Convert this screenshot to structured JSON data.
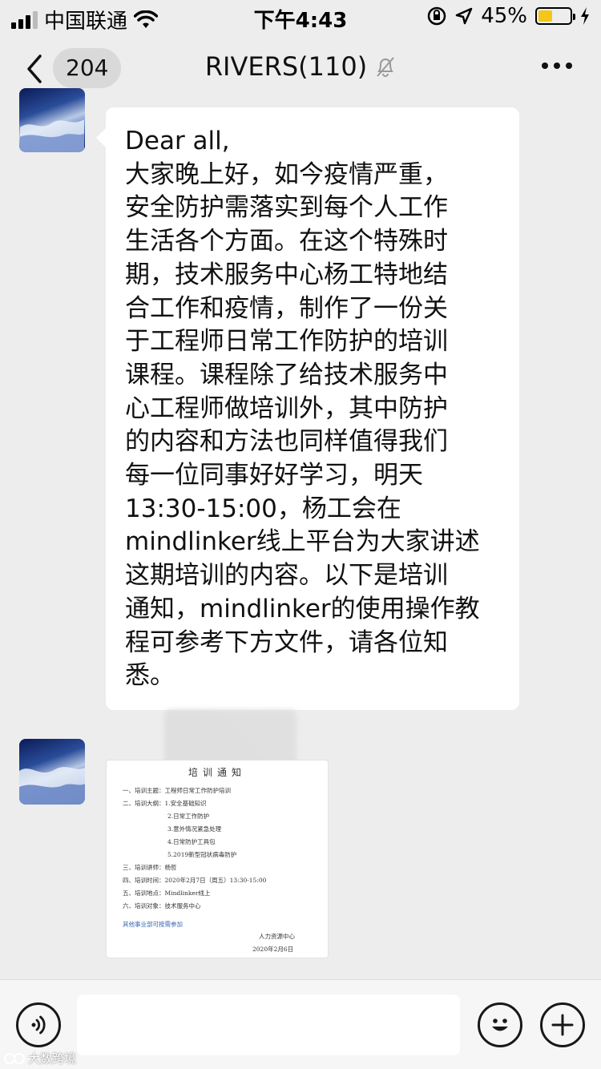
{
  "status_bar": {
    "carrier": "中国联通",
    "time": "下午4:43",
    "battery_percent": "45%",
    "battery_level": 0.45
  },
  "nav": {
    "back_icon": "chevron-left-icon",
    "unread_count": "204",
    "title": "RIVERS(110)",
    "mute_icon": "bell-off-icon",
    "more_icon": "more-dots-icon"
  },
  "messages": [
    {
      "type": "text",
      "text": "Dear all,\n大家晚上好，如今疫情严重，\n安全防护需落实到每个人工作\n生活各个方面。在这个特殊时\n期，技术服务中心杨工特地结\n合工作和疫情，制作了一份关\n于工程师日常工作防护的培训\n课程。课程除了给技术服务中\n心工程师做培训外，其中防护\n的内容和方法也同样值得我们\n每一位同事好好学习，明天\n13:30-15:00，杨工会在\nmindlinker线上平台为大家讲述\n这期培训的内容。以下是培训\n通知，mindlinker的使用操作教\n程可参考下方文件，请各位知\n悉。"
    },
    {
      "type": "image",
      "doc": {
        "title": "培训通知",
        "lines": [
          "一、培训主题：工程师日常工作防护培训",
          "二、培训大纲：1.安全基础知识",
          "2.日常工作防护",
          "3.意外情况紧急处理",
          "4.日常防护工具包",
          "5.2019新型冠状病毒防护",
          "三、培训讲师：杨哲",
          "四、培训时间：2020年2月7日（周五）13:30-15:00",
          "五、培训地点：Mindlinker线上",
          "六、培训对象：技术服务中心",
          "其他事业部可按需参加",
          "人力资源中心",
          "2020年2月6日"
        ]
      }
    }
  ],
  "input_bar": {
    "voice_icon": "voice-icon",
    "input_value": "",
    "emoji_icon": "emoji-icon",
    "plus_icon": "plus-icon"
  },
  "watermark": "大数跨境"
}
